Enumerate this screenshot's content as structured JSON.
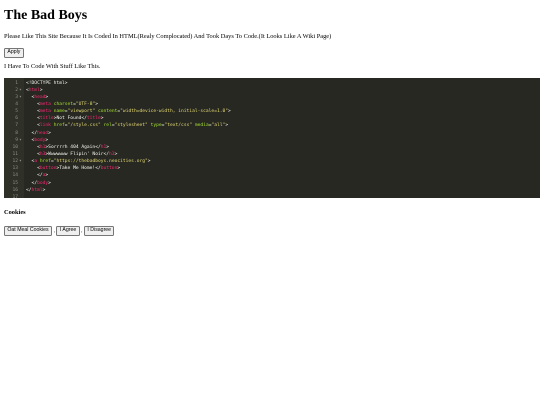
{
  "page": {
    "title": "The Bad Boys",
    "intro": "Please Like This Site Because It Is Coded In HTML(Realy Complocated) And Took Days To Code.(It Looks Like A Wiki Page)",
    "apply_label": "Apply",
    "note": "I Have To Code With Stuff Like This."
  },
  "code_editor": {
    "lines": [
      {
        "num": "1",
        "fold": "",
        "indent": "",
        "parts": [
          {
            "cls": "t-txt",
            "text": "<!DOCTYPE html>"
          }
        ]
      },
      {
        "num": "2",
        "fold": "▾",
        "indent": "",
        "parts": [
          {
            "cls": "t-txt",
            "text": "<"
          },
          {
            "cls": "t-tag",
            "text": "html"
          },
          {
            "cls": "t-txt",
            "text": ">"
          }
        ]
      },
      {
        "num": "3",
        "fold": "▾",
        "indent": "  ",
        "parts": [
          {
            "cls": "t-txt",
            "text": "<"
          },
          {
            "cls": "t-tag",
            "text": "head"
          },
          {
            "cls": "t-txt",
            "text": ">"
          }
        ]
      },
      {
        "num": "4",
        "fold": "",
        "indent": "    ",
        "parts": [
          {
            "cls": "t-txt",
            "text": "<"
          },
          {
            "cls": "t-tag",
            "text": "meta "
          },
          {
            "cls": "t-attr",
            "text": "charset"
          },
          {
            "cls": "t-txt",
            "text": "="
          },
          {
            "cls": "t-str",
            "text": "\"UTF-8\""
          },
          {
            "cls": "t-txt",
            "text": ">"
          }
        ]
      },
      {
        "num": "5",
        "fold": "",
        "indent": "    ",
        "parts": [
          {
            "cls": "t-txt",
            "text": "<"
          },
          {
            "cls": "t-tag",
            "text": "meta "
          },
          {
            "cls": "t-attr",
            "text": "name"
          },
          {
            "cls": "t-txt",
            "text": "="
          },
          {
            "cls": "t-str",
            "text": "\"viewport\" "
          },
          {
            "cls": "t-attr",
            "text": "content"
          },
          {
            "cls": "t-txt",
            "text": "="
          },
          {
            "cls": "t-str",
            "text": "\"width=device-width, initial-scale=1.0\""
          },
          {
            "cls": "t-txt",
            "text": ">"
          }
        ]
      },
      {
        "num": "6",
        "fold": "",
        "indent": "    ",
        "parts": [
          {
            "cls": "t-txt",
            "text": "<"
          },
          {
            "cls": "t-tag",
            "text": "title"
          },
          {
            "cls": "t-txt",
            "text": ">Not Found</"
          },
          {
            "cls": "t-tag",
            "text": "title"
          },
          {
            "cls": "t-txt",
            "text": ">"
          }
        ]
      },
      {
        "num": "7",
        "fold": "",
        "indent": "    ",
        "parts": [
          {
            "cls": "t-txt",
            "text": "<"
          },
          {
            "cls": "t-tag",
            "text": "link "
          },
          {
            "cls": "t-attr",
            "text": "href"
          },
          {
            "cls": "t-txt",
            "text": "="
          },
          {
            "cls": "t-str",
            "text": "\"/style.css\" "
          },
          {
            "cls": "t-attr",
            "text": "rel"
          },
          {
            "cls": "t-txt",
            "text": "="
          },
          {
            "cls": "t-str",
            "text": "\"stylesheet\" "
          },
          {
            "cls": "t-attr",
            "text": "type"
          },
          {
            "cls": "t-txt",
            "text": "="
          },
          {
            "cls": "t-str",
            "text": "\"text/css\" "
          },
          {
            "cls": "t-attr",
            "text": "media"
          },
          {
            "cls": "t-txt",
            "text": "="
          },
          {
            "cls": "t-str",
            "text": "\"all\""
          },
          {
            "cls": "t-txt",
            "text": ">"
          }
        ]
      },
      {
        "num": "8",
        "fold": "",
        "indent": "  ",
        "parts": [
          {
            "cls": "t-txt",
            "text": "</"
          },
          {
            "cls": "t-tag",
            "text": "head"
          },
          {
            "cls": "t-txt",
            "text": ">"
          }
        ]
      },
      {
        "num": "9",
        "fold": "▾",
        "indent": "  ",
        "parts": [
          {
            "cls": "t-txt",
            "text": "<"
          },
          {
            "cls": "t-tag",
            "text": "body"
          },
          {
            "cls": "t-txt",
            "text": ">"
          }
        ]
      },
      {
        "num": "10",
        "fold": "",
        "indent": "    ",
        "parts": [
          {
            "cls": "t-txt",
            "text": "<"
          },
          {
            "cls": "t-tag",
            "text": "h1"
          },
          {
            "cls": "t-txt",
            "text": ">Sorrrrh 404 Again</"
          },
          {
            "cls": "t-tag",
            "text": "h1"
          },
          {
            "cls": "t-txt",
            "text": ">"
          }
        ]
      },
      {
        "num": "11",
        "fold": "",
        "indent": "    ",
        "parts": [
          {
            "cls": "t-txt",
            "text": "<"
          },
          {
            "cls": "t-tag",
            "text": "h3"
          },
          {
            "cls": "t-txt",
            "text": ">Wwwwwww Flipin' Noir</"
          },
          {
            "cls": "t-tag",
            "text": "h3"
          },
          {
            "cls": "t-txt",
            "text": ">"
          }
        ]
      },
      {
        "num": "12",
        "fold": "▾",
        "indent": "  ",
        "parts": [
          {
            "cls": "t-txt",
            "text": "<"
          },
          {
            "cls": "t-tag",
            "text": "a "
          },
          {
            "cls": "t-attr",
            "text": "href"
          },
          {
            "cls": "t-txt",
            "text": "="
          },
          {
            "cls": "t-str",
            "text": "\"https://thebadboys.neocities.org\""
          },
          {
            "cls": "t-txt",
            "text": ">"
          }
        ]
      },
      {
        "num": "13",
        "fold": "",
        "indent": "    ",
        "parts": [
          {
            "cls": "t-txt",
            "text": "<"
          },
          {
            "cls": "t-tag",
            "text": "button"
          },
          {
            "cls": "t-txt",
            "text": ">Take Me Home!</"
          },
          {
            "cls": "t-tag",
            "text": "button"
          },
          {
            "cls": "t-txt",
            "text": ">"
          }
        ]
      },
      {
        "num": "14",
        "fold": "",
        "indent": "    ",
        "parts": [
          {
            "cls": "t-txt",
            "text": "</"
          },
          {
            "cls": "t-tag",
            "text": "a"
          },
          {
            "cls": "t-txt",
            "text": ">"
          }
        ]
      },
      {
        "num": "15",
        "fold": "",
        "indent": "  ",
        "parts": [
          {
            "cls": "t-txt",
            "text": "</"
          },
          {
            "cls": "t-tag",
            "text": "body"
          },
          {
            "cls": "t-txt",
            "text": ">"
          }
        ]
      },
      {
        "num": "16",
        "fold": "",
        "indent": "",
        "parts": [
          {
            "cls": "t-txt",
            "text": "</"
          },
          {
            "cls": "t-tag",
            "text": "html"
          },
          {
            "cls": "t-txt",
            "text": ">"
          }
        ]
      },
      {
        "num": "17",
        "fold": "",
        "indent": "",
        "parts": []
      }
    ]
  },
  "cookies": {
    "heading": "Cookies",
    "buttons": [
      "Oat Meal Cookies",
      "I Agree",
      "I Disagree"
    ],
    "separator": ","
  }
}
